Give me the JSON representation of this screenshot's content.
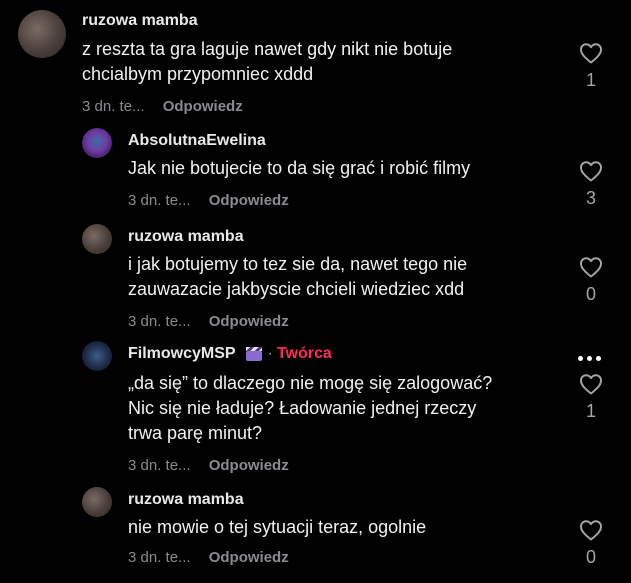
{
  "comments": [
    {
      "username": "ruzowa mamba",
      "text": "z reszta ta gra laguje nawet gdy nikt nie botuje\nchcialbym przypomniec xddd",
      "time": "3 dn. te...",
      "reply_label": "Odpowiedz",
      "likes": "1"
    },
    {
      "username": "AbsolutnaEwelina",
      "text": "Jak nie botujecie to da się grać i robić filmy",
      "time": "3 dn. te...",
      "reply_label": "Odpowiedz",
      "likes": "3"
    },
    {
      "username": "ruzowa mamba",
      "text": "i jak botujemy to tez sie da, nawet tego nie\nzauwazacie jakbyscie chcieli wiedziec xdd",
      "time": "3 dn. te...",
      "reply_label": "Odpowiedz",
      "likes": "0"
    },
    {
      "username": "FilmowcyMSP",
      "separator": "·",
      "badge": "Twórca",
      "text": "„da się” to dlaczego nie mogę się zalogować?\nNic się nie ładuje? Ładowanie jednej rzeczy\ntrwa parę minut?",
      "time": "3 dn. te...",
      "reply_label": "Odpowiedz",
      "likes": "1"
    },
    {
      "username": "ruzowa mamba",
      "text": "nie mowie o tej sytuacji teraz, ogolnie",
      "time": "3 dn. te...",
      "reply_label": "Odpowiedz",
      "likes": "0"
    }
  ],
  "icons": {
    "like": "heart-outline-icon",
    "more": "more-dots-icon",
    "creator": "clapperboard-icon"
  },
  "colors": {
    "background": "#000000",
    "creator_badge": "#fe2c55",
    "secondary_text": "#8a8b91"
  }
}
